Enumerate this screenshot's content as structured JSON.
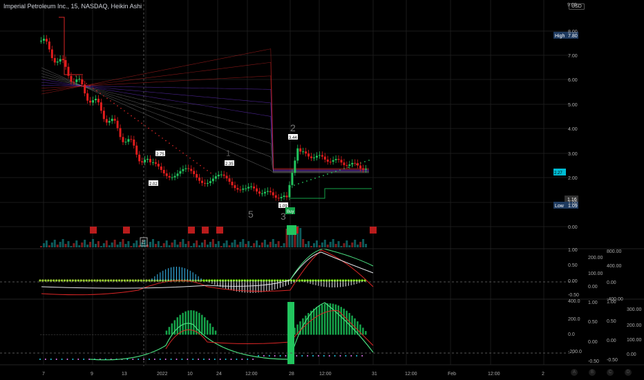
{
  "title": "Imperial Petroleum Inc., 15, NASDAQ, Heikin Ashi",
  "currency": "USD",
  "currency_top": "9.00",
  "badges": {
    "high_label": "High",
    "high_value": "7.80",
    "low_label": "Low",
    "low_value": "1.09",
    "last_value": "1.16",
    "cyan_value": "2.27"
  },
  "price_axis": [
    "8.00",
    "7.00",
    "6.00",
    "5.00",
    "4.00",
    "3.00",
    "2.00",
    "1.00",
    "0.00"
  ],
  "osc1_axis_a": [
    "1.00",
    "0.50",
    "0.00",
    "-0.50"
  ],
  "osc1_axis_b": [
    "800.00",
    "400.00",
    "0.00",
    "-400.00"
  ],
  "osc1_axis_c": [
    "200.00",
    "100.00",
    "0.00"
  ],
  "osc2_axis_a": [
    "400.0",
    "200.0",
    "0.0",
    "-200.0"
  ],
  "osc2_axis_b": [
    "1.00",
    "0.50",
    "0.00",
    "-0.50"
  ],
  "osc2_axis_c": [
    "1.00",
    "0.50",
    "0.00",
    "-0.50"
  ],
  "osc2_axis_d": [
    "300.00",
    "200.00",
    "100.00",
    "0.00"
  ],
  "time_axis": [
    "7",
    "9",
    "13",
    "2022",
    "10",
    "24",
    "12:00",
    "28",
    "12:00",
    "31",
    "12:00",
    "Feb",
    "12:00",
    "2"
  ],
  "annotations": {
    "wave2_top": "2",
    "wave1": "1",
    "wave5": "5",
    "wave3": "3",
    "p1": "2.75",
    "p2": "2.02",
    "p3": "2.35",
    "p4": "3.44",
    "p5": "1.09",
    "buy": "Buy",
    "e_marker": "E"
  },
  "pane_buttons": [
    "A",
    "B",
    "C",
    "D"
  ],
  "colors": {
    "up": "#22c55e",
    "down": "#e11d1d",
    "accent": "#2962ff",
    "cyan": "#00e5ff"
  }
}
